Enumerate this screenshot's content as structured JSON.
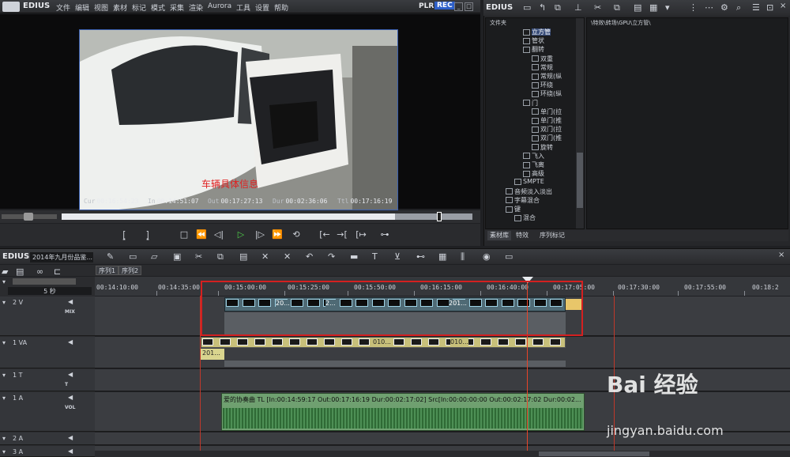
{
  "app": {
    "name": "EDIUS",
    "plr": "PLR",
    "rec": "REC"
  },
  "menu": [
    "文件",
    "编辑",
    "视图",
    "素材",
    "标记",
    "模式",
    "采集",
    "渲染",
    "Aurora",
    "工具",
    "设置",
    "帮助"
  ],
  "window_buttons": [
    "_",
    "□",
    "×"
  ],
  "monitor": {
    "overlay_text": "车辆具体信息",
    "timecodes": [
      {
        "label": "Cur",
        "value": "00:16:54:23"
      },
      {
        "label": "In",
        "value": "00:14:51:07"
      },
      {
        "label": "Out",
        "value": "00:17:27:13"
      },
      {
        "label": "Dur",
        "value": "00:02:36:06"
      },
      {
        "label": "Ttl",
        "value": "00:17:16:19"
      }
    ]
  },
  "transport_icons": [
    "mark-in-icon",
    "mark-out-icon",
    "stop-icon",
    "rewind-icon",
    "step-back-icon",
    "play-icon",
    "step-forward-icon",
    "fast-forward-icon",
    "loop-icon",
    "insert-icon",
    "overwrite-icon",
    "extract-icon",
    "lift-icon"
  ],
  "bin": {
    "title": "EDIUS",
    "folder_header": "文件夹",
    "path": "\\特效\\转场\\GPU\\立方管\\",
    "tree": [
      {
        "label": "立方管",
        "indent": 3,
        "selected": true
      },
      {
        "label": "管状",
        "indent": 3
      },
      {
        "label": "翻转",
        "indent": 3
      },
      {
        "label": "双重",
        "indent": 4
      },
      {
        "label": "常规",
        "indent": 4
      },
      {
        "label": "常规(纵",
        "indent": 4
      },
      {
        "label": "环绕",
        "indent": 4
      },
      {
        "label": "环绕(纵",
        "indent": 4
      },
      {
        "label": "门",
        "indent": 3
      },
      {
        "label": "单门(拉",
        "indent": 4
      },
      {
        "label": "单门(推",
        "indent": 4
      },
      {
        "label": "双门(拉",
        "indent": 4
      },
      {
        "label": "双门(推",
        "indent": 4
      },
      {
        "label": "旋转",
        "indent": 4
      },
      {
        "label": "飞入",
        "indent": 3
      },
      {
        "label": "飞离",
        "indent": 3
      },
      {
        "label": "高级",
        "indent": 3
      },
      {
        "label": "SMPTE",
        "indent": 2
      },
      {
        "label": "音频淡入淡出",
        "indent": 1
      },
      {
        "label": "字幕混合",
        "indent": 1
      },
      {
        "label": "键",
        "indent": 1
      },
      {
        "label": "混合",
        "indent": 2
      }
    ],
    "tabs": [
      "素材库",
      "特效",
      "序列标记"
    ]
  },
  "timeline": {
    "app": "EDIUS",
    "project": "2014年九月份品鉴...",
    "sequences": [
      "序列1",
      "序列2"
    ],
    "zoom": "5 秒",
    "ruler": [
      "00:14:10:00",
      "00:14:35:00",
      "00:15:00:00",
      "00:15:25:00",
      "00:15:50:00",
      "00:16:15:00",
      "00:16:40:00",
      "00:17:05:00",
      "00:17:30:00",
      "00:17:55:00",
      "00:18:2"
    ],
    "tracks": [
      {
        "name": "2 V",
        "tag": "MIX"
      },
      {
        "name": "1 VA",
        "tag": ""
      },
      {
        "name": "1 T",
        "tag": "T"
      },
      {
        "name": "1 A",
        "tag": "VOL"
      },
      {
        "name": "2 A",
        "tag": ""
      },
      {
        "name": "3 A",
        "tag": ""
      }
    ],
    "v_clips": [
      "20...",
      "2...",
      "201...",
      "201...",
      "010...",
      "010..."
    ],
    "audio_label": "爱的协奏曲  TL [In:00:14:59:17 Out:00:17:16:19 Dur:00:02:17:02]  Src[In:00:00:00:00 Out:00:02:17:02 Dur:00:02..."
  },
  "watermark": {
    "logo": "Bai 经验",
    "url": "jingyan.baidu.com"
  }
}
